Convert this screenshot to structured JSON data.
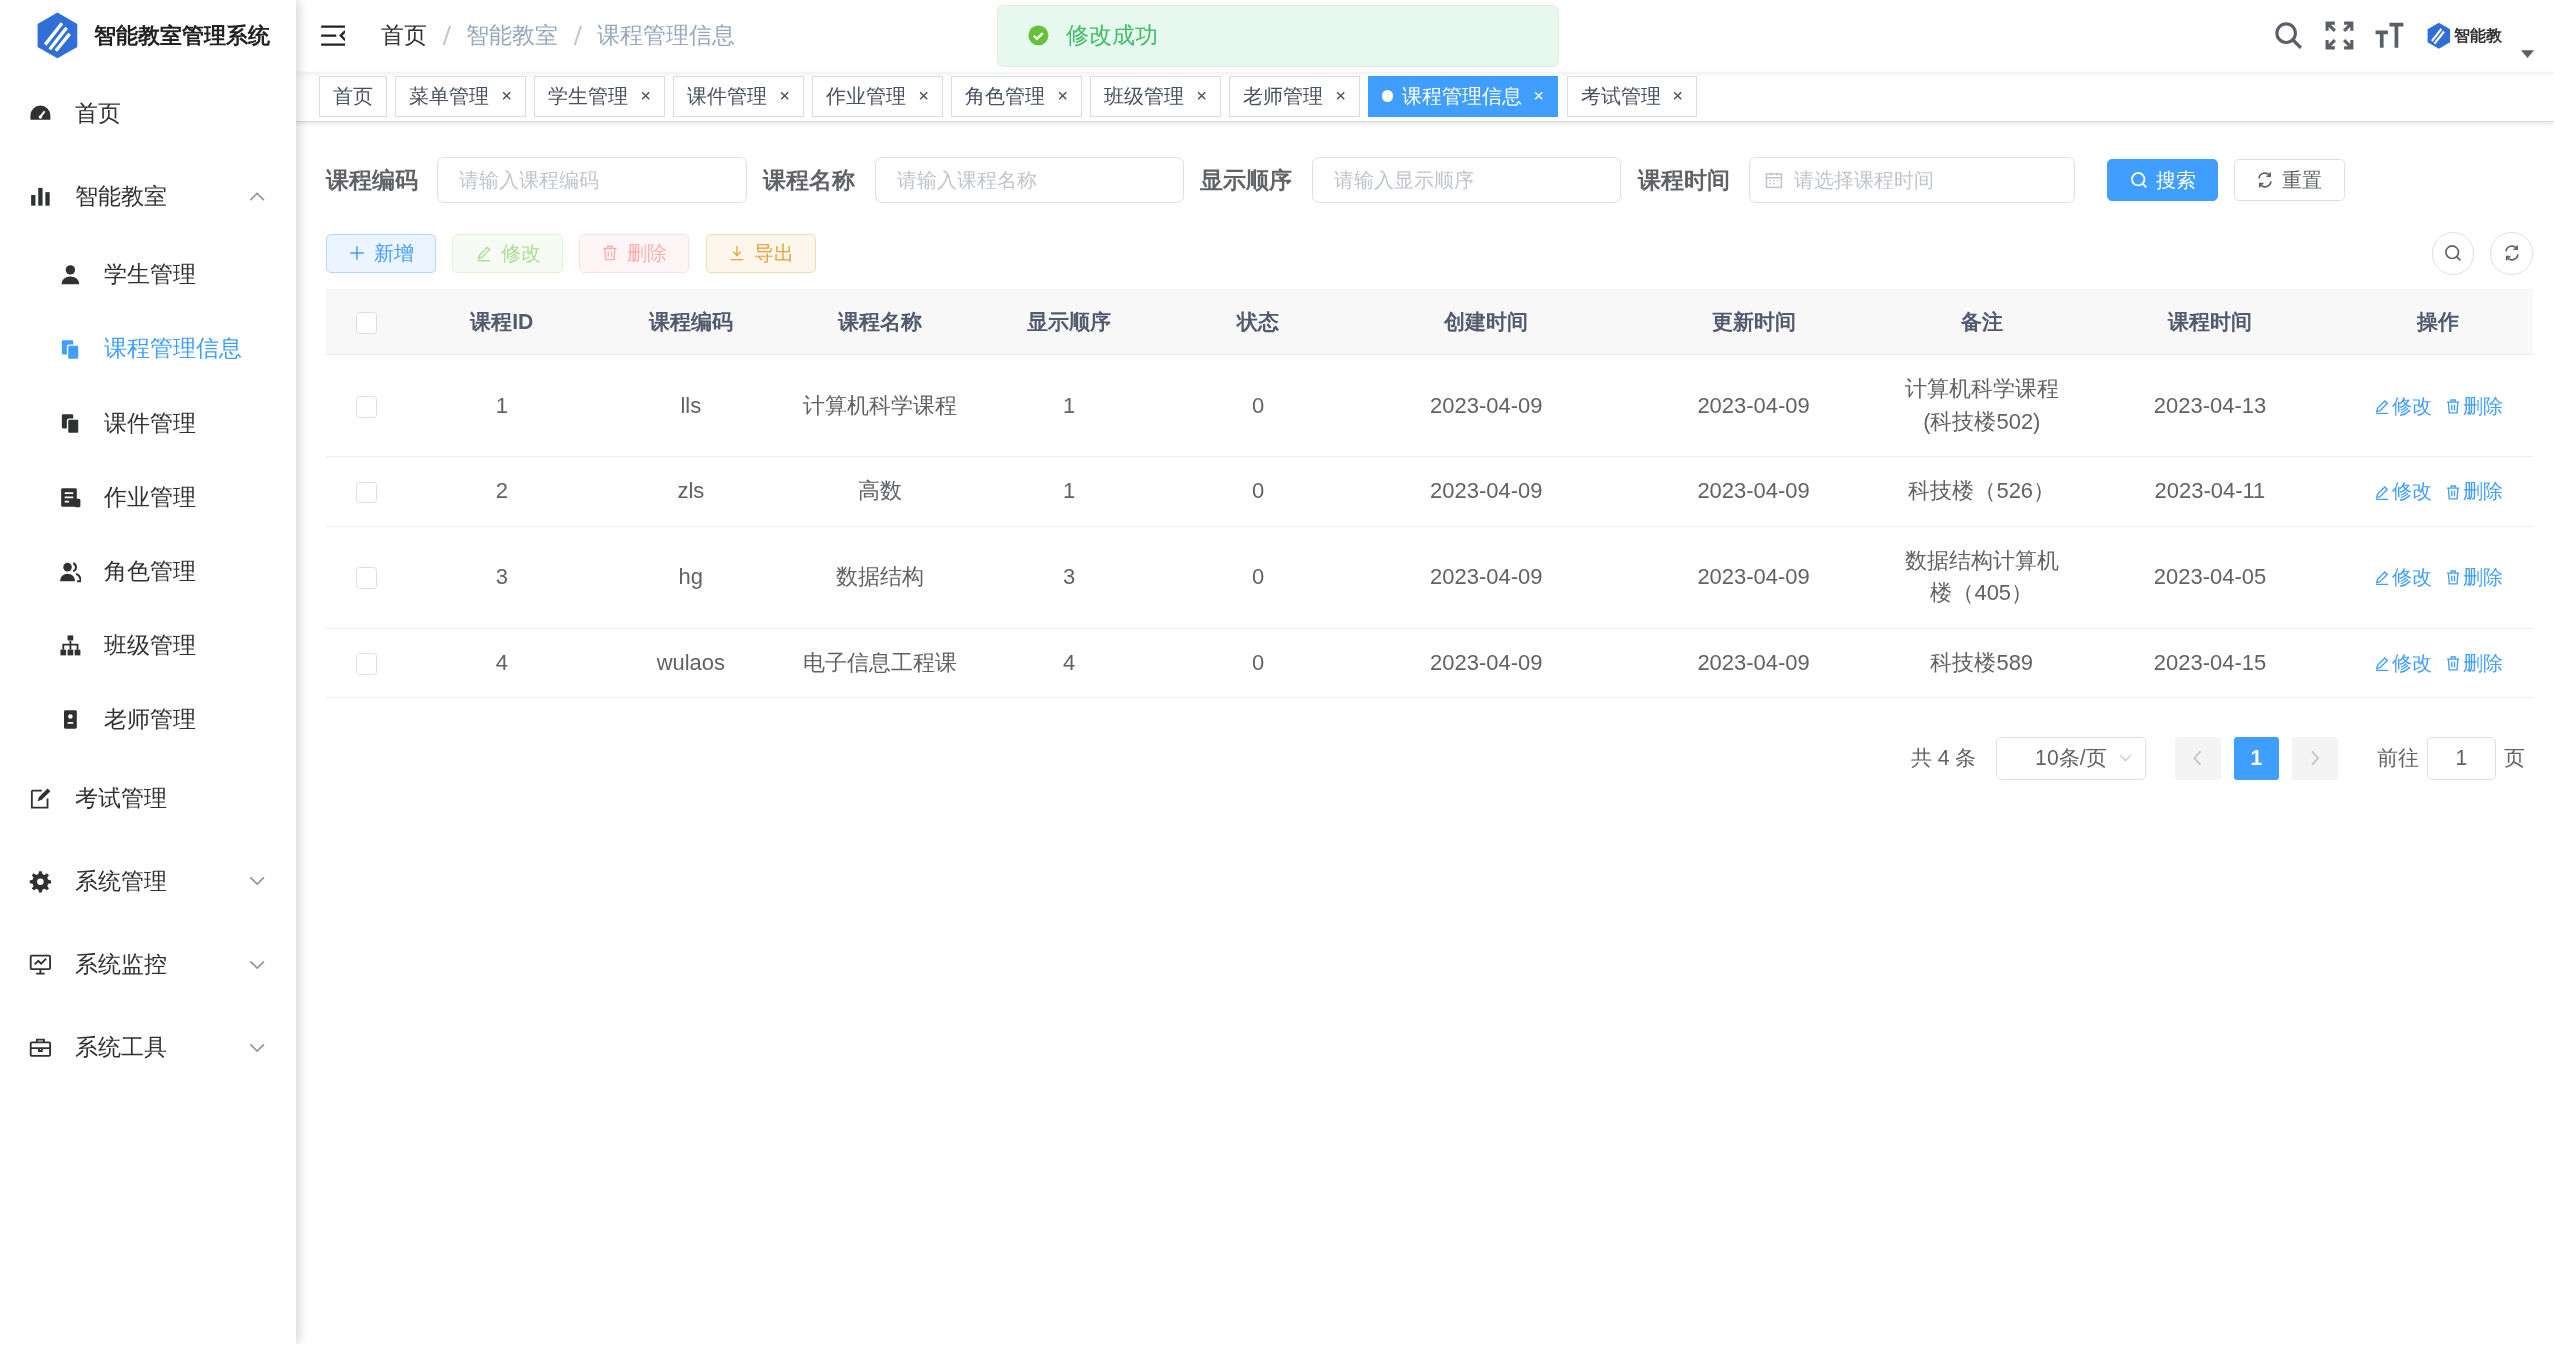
{
  "sidebar": {
    "title": "智能教室管理系统",
    "items": [
      {
        "label": "首页",
        "kind": "dashboard",
        "selected": false
      },
      {
        "label": "智能教室",
        "kind": "chart",
        "selected": false,
        "expanded": true,
        "children": [
          {
            "label": "学生管理",
            "kind": "user",
            "selected": false
          },
          {
            "label": "课程管理信息",
            "kind": "copy",
            "selected": true
          },
          {
            "label": "课件管理",
            "kind": "copy",
            "selected": false
          },
          {
            "label": "作业管理",
            "kind": "form",
            "selected": false
          },
          {
            "label": "角色管理",
            "kind": "peoples",
            "selected": false
          },
          {
            "label": "班级管理",
            "kind": "tree",
            "selected": false
          },
          {
            "label": "老师管理",
            "kind": "guide",
            "selected": false
          }
        ]
      },
      {
        "label": "考试管理",
        "kind": "edit",
        "selected": false
      },
      {
        "label": "系统管理",
        "kind": "system",
        "selected": false,
        "expanded": false
      },
      {
        "label": "系统监控",
        "kind": "monitor",
        "selected": false,
        "expanded": false
      },
      {
        "label": "系统工具",
        "kind": "tool",
        "selected": false,
        "expanded": false
      }
    ]
  },
  "breadcrumb": [
    {
      "label": "首页",
      "link": true
    },
    {
      "label": "智能教室",
      "link": false
    },
    {
      "label": "课程管理信息",
      "link": false
    }
  ],
  "avatar_text": "智能教",
  "toast": {
    "message": "修改成功",
    "kind": "success"
  },
  "tabs": [
    {
      "label": "首页",
      "selected": false,
      "closable": false
    },
    {
      "label": "菜单管理",
      "selected": false,
      "closable": true
    },
    {
      "label": "学生管理",
      "selected": false,
      "closable": true
    },
    {
      "label": "课件管理",
      "selected": false,
      "closable": true
    },
    {
      "label": "作业管理",
      "selected": false,
      "closable": true
    },
    {
      "label": "角色管理",
      "selected": false,
      "closable": true
    },
    {
      "label": "班级管理",
      "selected": false,
      "closable": true
    },
    {
      "label": "老师管理",
      "selected": false,
      "closable": true
    },
    {
      "label": "课程管理信息",
      "selected": true,
      "closable": true
    },
    {
      "label": "考试管理",
      "selected": false,
      "closable": true
    }
  ],
  "search": {
    "fields": [
      {
        "label": "课程编码",
        "placeholder": "请输入课程编码",
        "kind": "text"
      },
      {
        "label": "课程名称",
        "placeholder": "请输入课程名称",
        "kind": "text"
      },
      {
        "label": "显示顺序",
        "placeholder": "请输入显示顺序",
        "kind": "text"
      },
      {
        "label": "课程时间",
        "placeholder": "请选择课程时间",
        "kind": "date"
      }
    ],
    "buttons": [
      {
        "label": "搜索",
        "kind": "primary"
      },
      {
        "label": "重置",
        "kind": "default"
      }
    ]
  },
  "toolbar": [
    {
      "label": "新增",
      "kind": "primary",
      "disabled": false
    },
    {
      "label": "修改",
      "kind": "success",
      "disabled": true
    },
    {
      "label": "删除",
      "kind": "danger",
      "disabled": true
    },
    {
      "label": "导出",
      "kind": "warning",
      "disabled": false
    }
  ],
  "table": {
    "all_checked": false,
    "columns": [
      "课程ID",
      "课程编码",
      "课程名称",
      "显示顺序",
      "状态",
      "创建时间",
      "更新时间",
      "备注",
      "课程时间",
      "操作"
    ],
    "rows": [
      {
        "checked": false,
        "cells": [
          "1",
          "lls",
          "计算机科学课程",
          "1",
          "0",
          "2023-04-09",
          "2023-04-09",
          "计算机科学课程(科技楼502)",
          "2023-04-13"
        ],
        "actions": [
          {
            "label": "修改",
            "kind": "edit"
          },
          {
            "label": "删除",
            "kind": "delete"
          }
        ]
      },
      {
        "checked": false,
        "cells": [
          "2",
          "zls",
          "高数",
          "1",
          "0",
          "2023-04-09",
          "2023-04-09",
          "科技楼（526）",
          "2023-04-11"
        ],
        "actions": [
          {
            "label": "修改",
            "kind": "edit"
          },
          {
            "label": "删除",
            "kind": "delete"
          }
        ]
      },
      {
        "checked": false,
        "cells": [
          "3",
          "hg",
          "数据结构",
          "3",
          "0",
          "2023-04-09",
          "2023-04-09",
          "数据结构计算机楼（405）",
          "2023-04-05"
        ],
        "actions": [
          {
            "label": "修改",
            "kind": "edit"
          },
          {
            "label": "删除",
            "kind": "delete"
          }
        ]
      },
      {
        "checked": false,
        "cells": [
          "4",
          "wulaos",
          "电子信息工程课",
          "4",
          "0",
          "2023-04-09",
          "2023-04-09",
          "科技楼589",
          "2023-04-15"
        ],
        "actions": [
          {
            "label": "修改",
            "kind": "edit"
          },
          {
            "label": "删除",
            "kind": "delete"
          }
        ]
      }
    ]
  },
  "pagination": {
    "total": "共 4 条",
    "page_size": "10条/页",
    "pages": [
      {
        "label": "1",
        "selected": true
      }
    ],
    "jump_label": "前往",
    "jump_value": "1",
    "jump_suffix": "页"
  }
}
